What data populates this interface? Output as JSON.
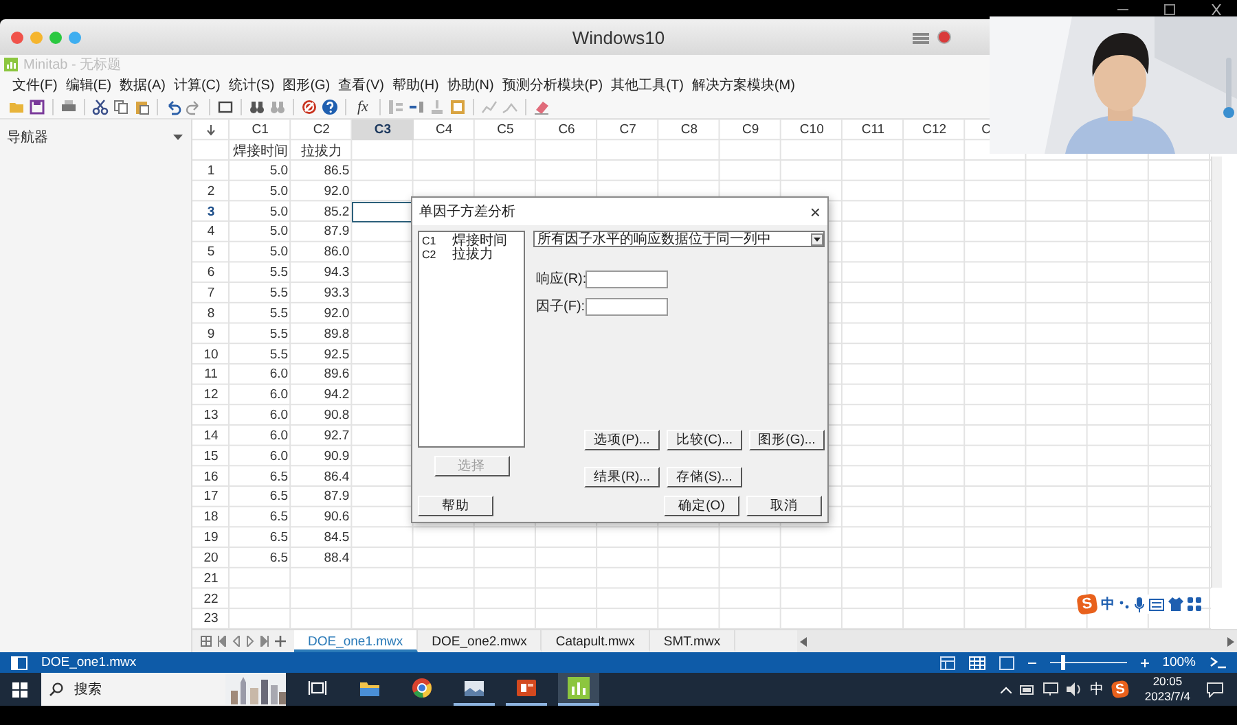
{
  "window": {
    "title": "Windows10"
  },
  "app": {
    "title": "Minitab - 无标题"
  },
  "menu": [
    "文件(F)",
    "编辑(E)",
    "数据(A)",
    "计算(C)",
    "统计(S)",
    "图形(G)",
    "查看(V)",
    "帮助(H)",
    "协助(N)",
    "预测分析模块(P)",
    "其他工具(T)",
    "解决方案模块(M)"
  ],
  "toolbar": {
    "formula_label": "fx"
  },
  "navigator": {
    "title": "导航器"
  },
  "sheet": {
    "columns": [
      {
        "label": "C1",
        "selected": false
      },
      {
        "label": "C2",
        "selected": false
      },
      {
        "label": "C3",
        "selected": true
      },
      {
        "label": "C4",
        "selected": false
      },
      {
        "label": "C5",
        "selected": false
      },
      {
        "label": "C6",
        "selected": false
      },
      {
        "label": "C7",
        "selected": false
      },
      {
        "label": "C8",
        "selected": false
      },
      {
        "label": "C9",
        "selected": false
      },
      {
        "label": "C10",
        "selected": false
      },
      {
        "label": "C11",
        "selected": false
      },
      {
        "label": "C12",
        "selected": false
      },
      {
        "label": "C",
        "selected": false
      }
    ],
    "column_names": [
      "焊接时间",
      "拉拔力"
    ],
    "rows": [
      {
        "label": "1",
        "selected": false,
        "cells": [
          "5.0",
          "86.5"
        ]
      },
      {
        "label": "2",
        "selected": false,
        "cells": [
          "5.0",
          "92.0"
        ]
      },
      {
        "label": "3",
        "selected": true,
        "cells": [
          "5.0",
          "85.2"
        ]
      },
      {
        "label": "4",
        "selected": false,
        "cells": [
          "5.0",
          "87.9"
        ]
      },
      {
        "label": "5",
        "selected": false,
        "cells": [
          "5.0",
          "86.0"
        ]
      },
      {
        "label": "6",
        "selected": false,
        "cells": [
          "5.5",
          "94.3"
        ]
      },
      {
        "label": "7",
        "selected": false,
        "cells": [
          "5.5",
          "93.3"
        ]
      },
      {
        "label": "8",
        "selected": false,
        "cells": [
          "5.5",
          "92.0"
        ]
      },
      {
        "label": "9",
        "selected": false,
        "cells": [
          "5.5",
          "89.8"
        ]
      },
      {
        "label": "10",
        "selected": false,
        "cells": [
          "5.5",
          "92.5"
        ]
      },
      {
        "label": "11",
        "selected": false,
        "cells": [
          "6.0",
          "89.6"
        ]
      },
      {
        "label": "12",
        "selected": false,
        "cells": [
          "6.0",
          "94.2"
        ]
      },
      {
        "label": "13",
        "selected": false,
        "cells": [
          "6.0",
          "90.8"
        ]
      },
      {
        "label": "14",
        "selected": false,
        "cells": [
          "6.0",
          "92.7"
        ]
      },
      {
        "label": "15",
        "selected": false,
        "cells": [
          "6.0",
          "90.9"
        ]
      },
      {
        "label": "16",
        "selected": false,
        "cells": [
          "6.5",
          "86.4"
        ]
      },
      {
        "label": "17",
        "selected": false,
        "cells": [
          "6.5",
          "87.9"
        ]
      },
      {
        "label": "18",
        "selected": false,
        "cells": [
          "6.5",
          "90.6"
        ]
      },
      {
        "label": "19",
        "selected": false,
        "cells": [
          "6.5",
          "84.5"
        ]
      },
      {
        "label": "20",
        "selected": false,
        "cells": [
          "6.5",
          "88.4"
        ]
      },
      {
        "label": "21",
        "selected": false,
        "cells": []
      },
      {
        "label": "22",
        "selected": false,
        "cells": []
      },
      {
        "label": "23",
        "selected": false,
        "cells": []
      }
    ]
  },
  "sheet_tabs": [
    {
      "label": "DOE_one1.mwx",
      "selected": true
    },
    {
      "label": "DOE_one2.mwx",
      "selected": false
    },
    {
      "label": "Catapult.mwx",
      "selected": false
    },
    {
      "label": "SMT.mwx",
      "selected": false
    }
  ],
  "dialog": {
    "title": "单因子方差分析",
    "close": "×",
    "variables": [
      {
        "id": "C1",
        "name": "焊接时间"
      },
      {
        "id": "C2",
        "name": "拉拔力"
      }
    ],
    "select_button": {
      "label": "选择",
      "disabled": true
    },
    "layout_option": "所有因子水平的响应数据位于同一列中",
    "fields": [
      {
        "label": "响应(R):"
      },
      {
        "label": "因子(F):"
      }
    ],
    "button_rows": [
      [
        {
          "label": "选项(P)..."
        },
        {
          "label": "比较(C)..."
        },
        {
          "label": "图形(G)..."
        }
      ],
      [
        {
          "label": "结果(R)..."
        },
        {
          "label": "存储(S)..."
        }
      ]
    ],
    "help_button": "帮助",
    "ok_button": "确定(O)",
    "cancel_button": "取消"
  },
  "ime": {
    "logo": "S",
    "mode": "中"
  },
  "status_bar": {
    "file": "DOE_one1.mwx",
    "zoom": {
      "level": 0.15,
      "reading": "100%"
    }
  },
  "taskbar": {
    "search": {
      "placeholder": "搜索"
    },
    "apps": [
      {
        "kind": "task-view",
        "running": false,
        "selected": false
      },
      {
        "kind": "folder",
        "running": false,
        "selected": false
      },
      {
        "kind": "browser",
        "running": false,
        "selected": false
      },
      {
        "kind": "photos",
        "running": true,
        "selected": false
      },
      {
        "kind": "slides",
        "running": true,
        "selected": false
      },
      {
        "kind": "chart",
        "running": true,
        "selected": true
      }
    ],
    "tray": {
      "ime_mode": "中",
      "ime_logo": "S",
      "time": "20:05",
      "date": "2023/7/4"
    }
  }
}
